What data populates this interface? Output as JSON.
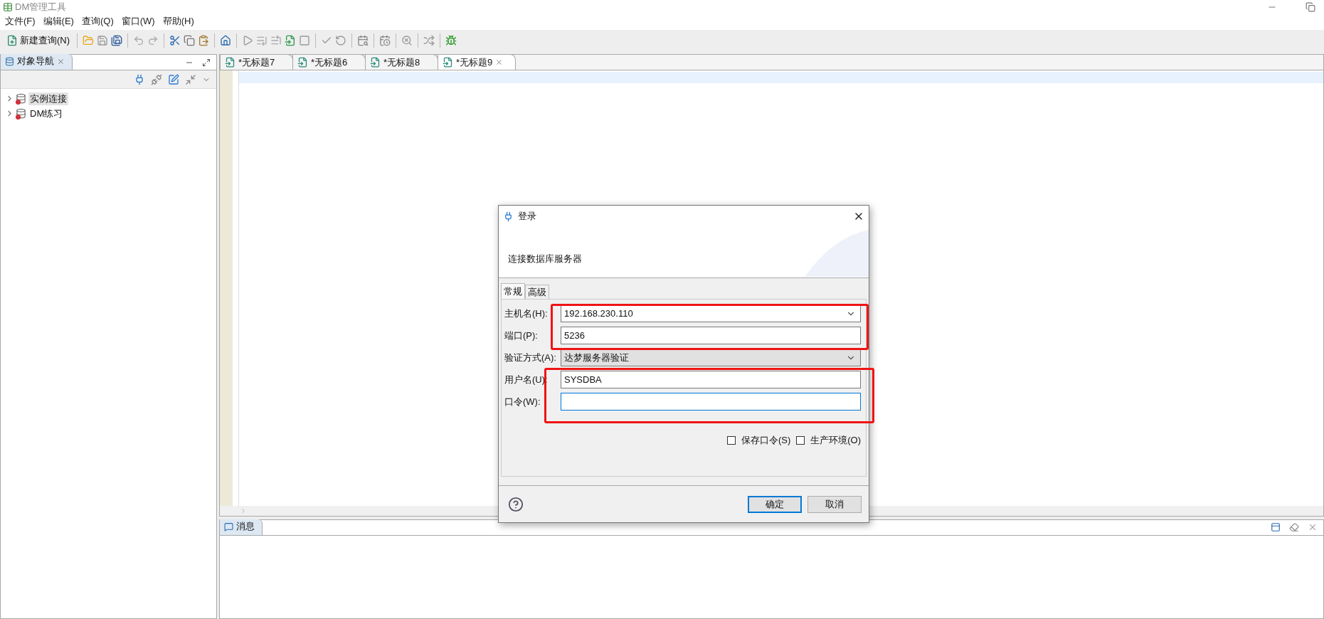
{
  "window": {
    "title": "DM管理工具"
  },
  "menu": [
    "文件(F)",
    "编辑(E)",
    "查询(Q)",
    "窗口(W)",
    "帮助(H)"
  ],
  "toolbar": {
    "new_query": "新建查询(N)"
  },
  "navigator": {
    "title": "对象导航",
    "tree": [
      {
        "label": "实例连接",
        "selected": true,
        "expanded": false
      },
      {
        "label": "DM练习",
        "selected": false,
        "expanded": false
      }
    ]
  },
  "editor_tabs": [
    {
      "label": "*无标题7",
      "selected": false
    },
    {
      "label": "*无标题6",
      "selected": false
    },
    {
      "label": "*无标题8",
      "selected": false
    },
    {
      "label": "*无标题9",
      "selected": true
    }
  ],
  "messages": {
    "title": "消息"
  },
  "dialog": {
    "title": "登录",
    "subtitle": "连接数据库服务器",
    "tabs": [
      {
        "label": "常规",
        "selected": true
      },
      {
        "label": "高级",
        "selected": false
      }
    ],
    "fields": [
      {
        "kind": "combo",
        "label": "主机名(H):",
        "value": "192.168.230.110",
        "focused": false
      },
      {
        "kind": "text",
        "label": "端口(P):",
        "value": "5236",
        "focused": false
      },
      {
        "kind": "select",
        "label": "验证方式(A):",
        "value": "达梦服务器验证",
        "focused": false
      },
      {
        "kind": "text",
        "label": "用户名(U):",
        "value": "SYSDBA",
        "focused": false
      },
      {
        "kind": "password",
        "label": "口令(W):",
        "focused": true
      }
    ],
    "checkboxes": [
      {
        "label": "保存口令(S)",
        "checked": false
      },
      {
        "label": "生产环境(O)",
        "checked": false
      }
    ],
    "buttons": [
      {
        "label": "确定",
        "default": true
      },
      {
        "label": "取消",
        "default": false
      }
    ]
  }
}
